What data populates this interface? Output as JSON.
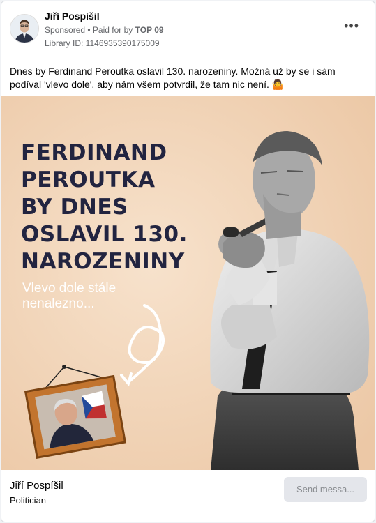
{
  "post": {
    "author": "Jiří Pospíšil",
    "sponsored": "Sponsored",
    "paid_prefix": "• Paid for by",
    "payer": "TOP 09",
    "library_id": "Library ID: 1146935390175009",
    "more_icon": "•••",
    "text": "Dnes by Ferdinand Peroutka oslavil 130. narozeniny. Možná už by se i sám podíval 'vlevo dole', aby nám všem potvrdil, že tam nic není. 🤷"
  },
  "ad_image": {
    "headline": [
      "FERDINAND",
      "PEROUTKA",
      "BY DNES",
      "OSLAVIL 130.",
      "NAROZENINY"
    ],
    "subline": [
      "Vlevo dole stále",
      "nenalezno..."
    ]
  },
  "footer": {
    "page_name": "Jiří Pospíšil",
    "category": "Politician",
    "cta": "Send messa..."
  },
  "colors": {
    "headline": "#222440",
    "background": "#f2d7bc",
    "button": "#e4e6eb"
  }
}
